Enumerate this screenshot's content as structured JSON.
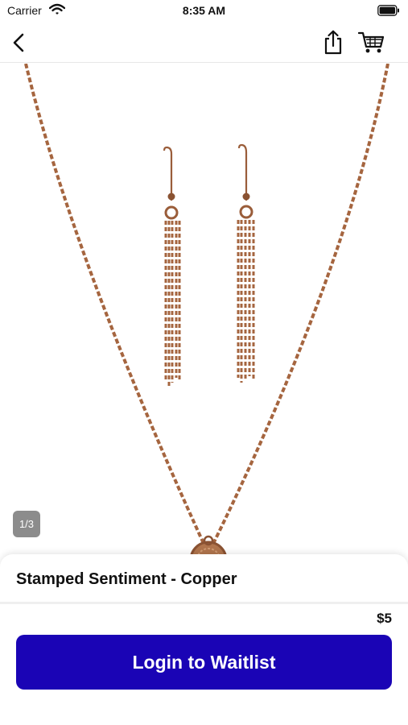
{
  "status_bar": {
    "carrier": "Carrier",
    "time": "8:35 AM",
    "wifi_icon": "wifi-icon",
    "battery_icon": "battery-icon"
  },
  "nav": {
    "back_icon": "chevron-left-icon",
    "share_icon": "share-icon",
    "cart_icon": "cart-icon"
  },
  "gallery": {
    "page_indicator": "1/3",
    "current_image": 1,
    "total_images": 3
  },
  "product": {
    "name": "Stamped Sentiment - Copper",
    "price": "$5"
  },
  "actions": {
    "waitlist_label": "Login to Waitlist"
  },
  "colors": {
    "primary_button": "#1a04b5",
    "copper": "#a5653f",
    "indicator_bg": "#8c8c8c"
  }
}
